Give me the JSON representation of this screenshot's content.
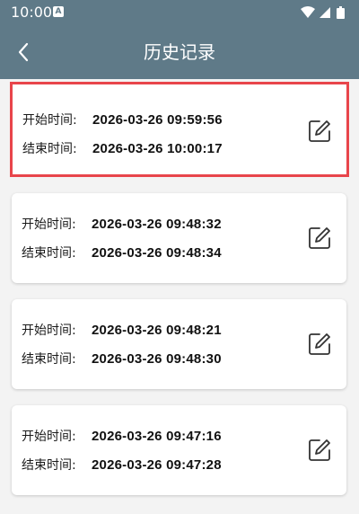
{
  "status_bar": {
    "time": "10:00",
    "notification_letter": "A"
  },
  "header": {
    "title": "历史记录"
  },
  "records": [
    {
      "start_label": "开始时间:",
      "start_value": "2026-03-26 09:59:56",
      "end_label": "结束时间:",
      "end_value": "2026-03-26 10:00:17"
    },
    {
      "start_label": "开始时间:",
      "start_value": "2026-03-26 09:48:32",
      "end_label": "结束时间:",
      "end_value": "2026-03-26 09:48:34"
    },
    {
      "start_label": "开始时间:",
      "start_value": "2026-03-26 09:48:21",
      "end_label": "结束时间:",
      "end_value": "2026-03-26 09:48:30"
    },
    {
      "start_label": "开始时间:",
      "start_value": "2026-03-26 09:47:16",
      "end_label": "结束时间:",
      "end_value": "2026-03-26 09:47:28"
    }
  ],
  "colors": {
    "header_bg": "#5f7a88",
    "highlight_border": "#e8454b",
    "page_bg": "#f3f3f3"
  },
  "icons": {
    "back": "chevron-left-icon",
    "edit": "edit-icon",
    "wifi": "wifi-icon",
    "signal": "signal-icon",
    "battery": "battery-icon"
  }
}
